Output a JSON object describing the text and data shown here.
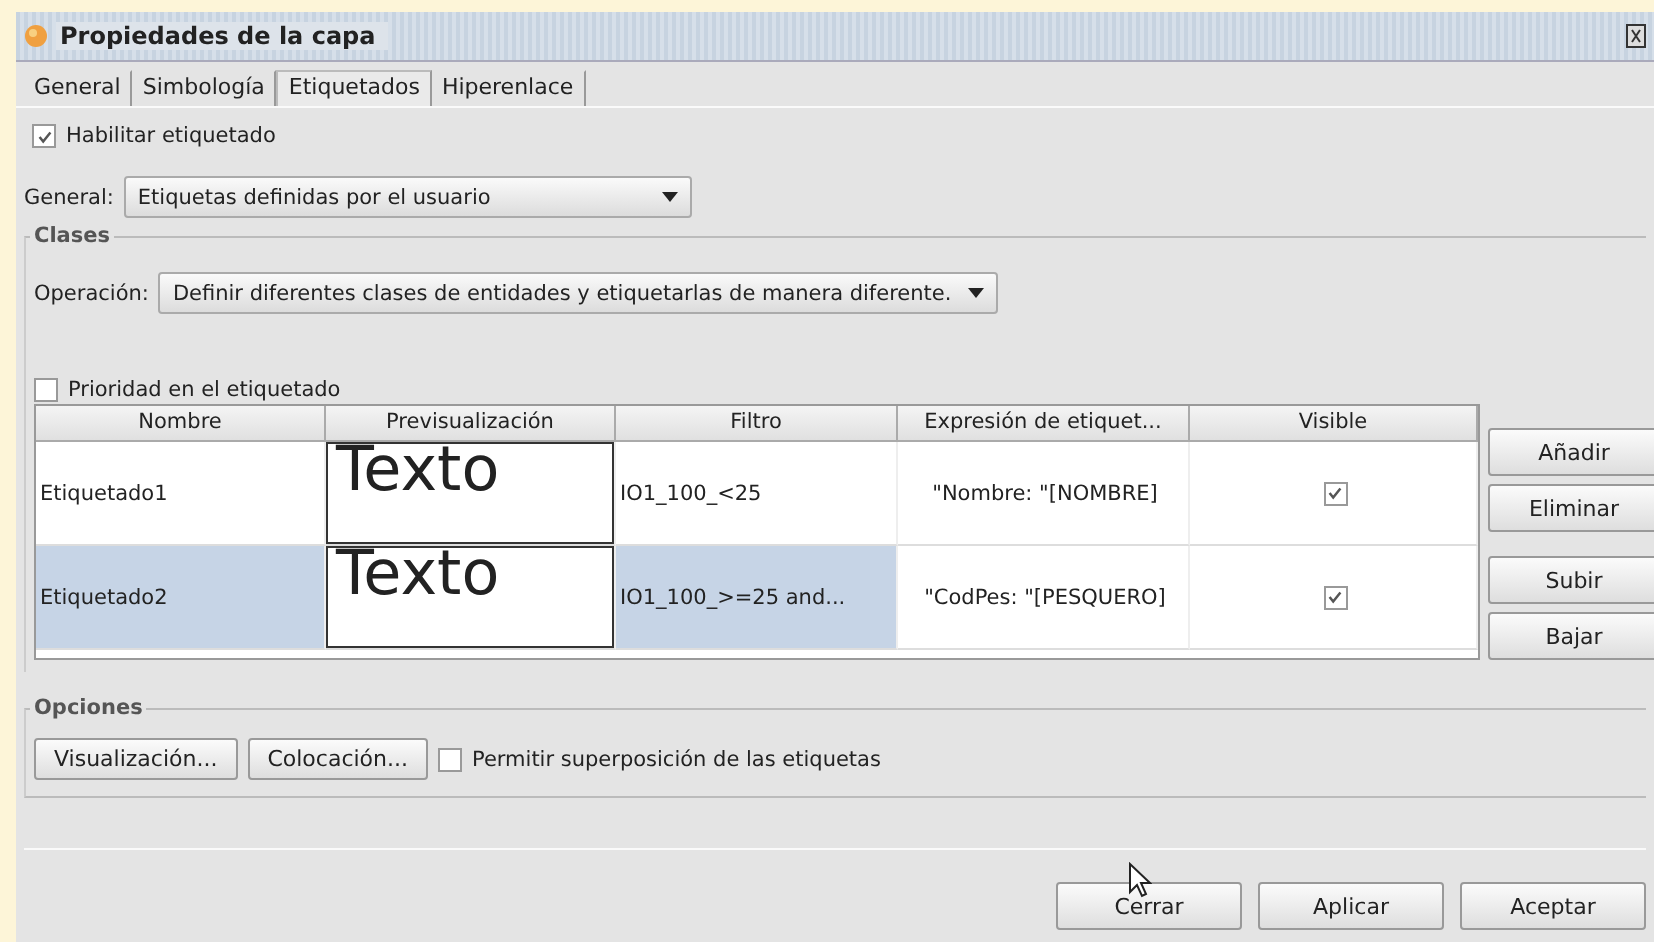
{
  "window": {
    "title": "Propiedades de la capa"
  },
  "tabs": [
    {
      "label": "General",
      "selected": false
    },
    {
      "label": "Simbología",
      "selected": false
    },
    {
      "label": "Etiquetados",
      "selected": true
    },
    {
      "label": "Hiperenlace",
      "selected": false
    }
  ],
  "enable_labeling": {
    "label": "Habilitar etiquetado",
    "checked": true
  },
  "general": {
    "label": "General:",
    "value": "Etiquetas definidas por el usuario"
  },
  "classes": {
    "title": "Clases",
    "operation_label": "Operación:",
    "operation_value": "Definir diferentes clases de entidades y etiquetarlas de manera diferente.",
    "priority": {
      "label": "Prioridad en el etiquetado",
      "checked": false
    },
    "table": {
      "columns": [
        "Nombre",
        "Previsualización",
        "Filtro",
        "Expresión de etiquet...",
        "Visible"
      ],
      "rows": [
        {
          "name": "Etiquetado1",
          "preview": "Texto",
          "filter": "IO1_100_<25",
          "expression": "\"Nombre: \"[NOMBRE]",
          "visible": true,
          "selected": false
        },
        {
          "name": "Etiquetado2",
          "preview": "Texto",
          "filter": "IO1_100_>=25 and...",
          "expression": "\"CodPes: \"[PESQUERO]",
          "visible": true,
          "selected": true
        }
      ]
    },
    "side_buttons": [
      "Añadir",
      "Eliminar",
      "Subir",
      "Bajar"
    ]
  },
  "options": {
    "title": "Opciones",
    "buttons": [
      "Visualización...",
      "Colocación..."
    ],
    "overlap": {
      "label": "Permitir superposición de las etiquetas",
      "checked": false
    }
  },
  "footer_buttons": [
    "Cerrar",
    "Aplicar",
    "Aceptar"
  ]
}
